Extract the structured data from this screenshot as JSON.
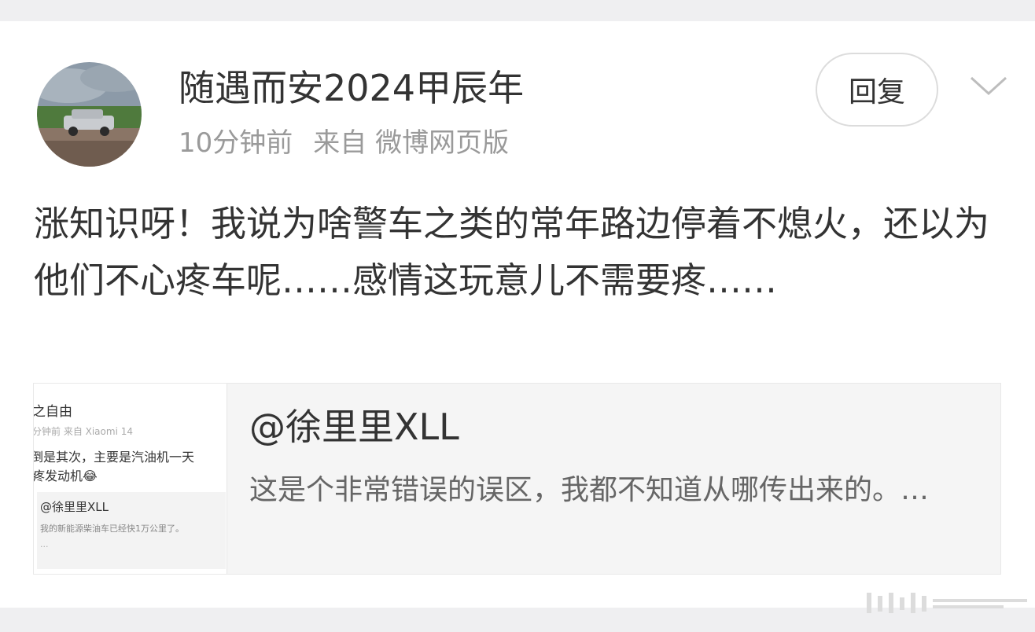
{
  "post": {
    "username": "随遇而安2024甲辰年",
    "time": "10分钟前",
    "source": "来自 微博网页版",
    "reply_label": "回复",
    "content": "涨知识呀！我说为啥警车之类的常年路边停着不熄火，还以为他们不心疼车呢……感情这玩意儿不需要疼……"
  },
  "quote": {
    "title": "@徐里里XLL",
    "body": "这是个非常错误的误区，我都不知道从哪传出来的。…",
    "thumbnail": {
      "line1": "之自由",
      "line2": "分钟前  来自 Xiaomi 14",
      "line3": "倒是其次，主要是汽油机一天",
      "line4": "疼发动机😂",
      "inner_title": "@徐里里XLL",
      "inner_body": "我的新能源柴油车已经快1万公里了。",
      "inner_more": "..."
    }
  },
  "icons": {
    "chevron": "chevron-down-icon",
    "avatar": "avatar"
  },
  "colors": {
    "background": "#efeff1",
    "card": "#ffffff",
    "text": "#333333",
    "meta": "#9a9a9a",
    "quote_bg": "#f5f5f5"
  }
}
